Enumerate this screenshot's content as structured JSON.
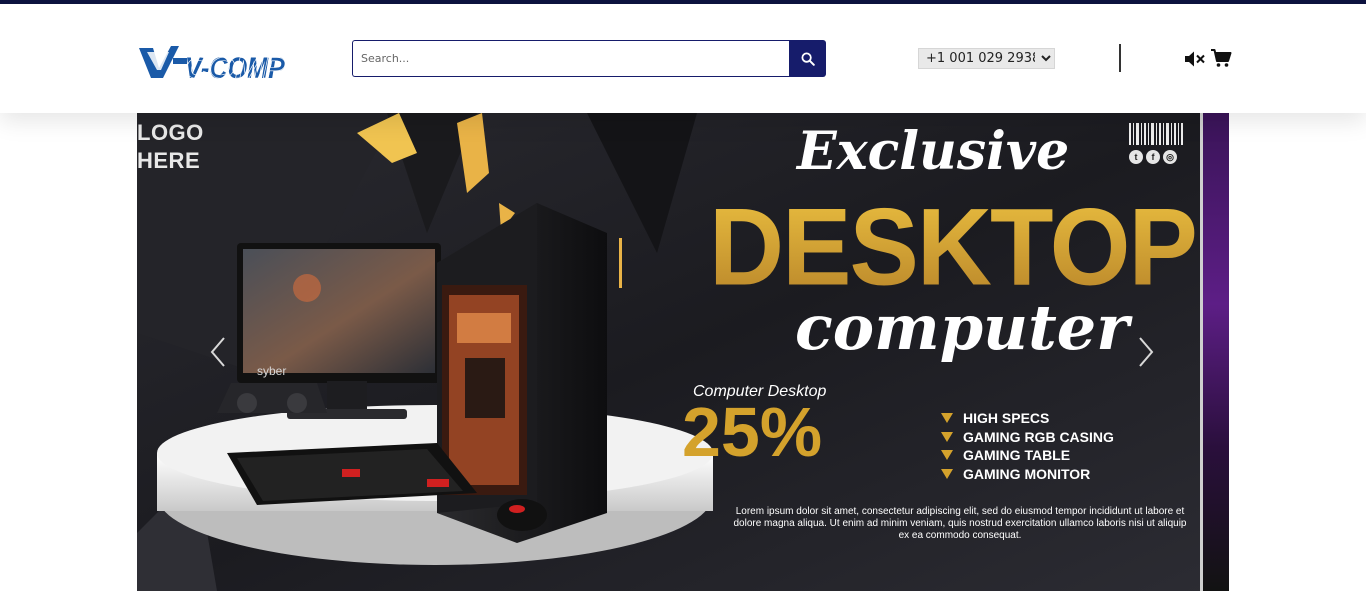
{
  "header": {
    "logo_text": "V-COMP",
    "search": {
      "placeholder": "Search...",
      "value": ""
    },
    "phone": {
      "selected": "+1 001 029 2938"
    },
    "icons": [
      "search-icon",
      "mute-icon",
      "cart-icon"
    ]
  },
  "banner": {
    "logo_line1": "LOGO",
    "logo_line2": "HERE",
    "headline_script": "Exclusive",
    "headline_main": "DESKTOP",
    "headline_sub": "computer",
    "offer_label": "Computer Desktop",
    "offer_value": "25%",
    "features": [
      "HIGH SPECS",
      "GAMING RGB CASING",
      "GAMING TABLE",
      "GAMING MONITOR"
    ],
    "body_text": "Lorem ipsum dolor sit amet, consectetur adipiscing elit, sed do eiusmod tempor incididunt ut labore et dolore magna aliqua. Ut enim ad minim veniam, quis nostrud exercitation ullamco laboris nisi ut aliquip ex ea commodo consequat.",
    "monitor_brand": "syber"
  },
  "colors": {
    "brand_navy": "#161c6b",
    "topbar": "#0d1340",
    "accent_gold": "#d4a22c"
  }
}
